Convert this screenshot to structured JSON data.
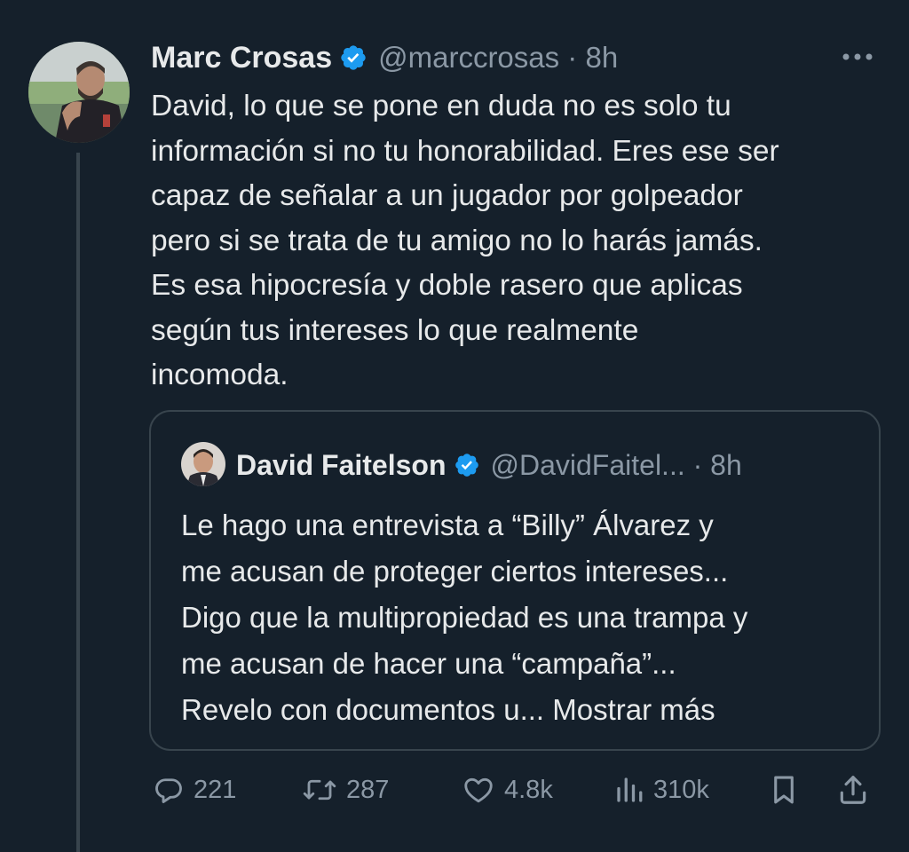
{
  "tweet": {
    "author_name": "Marc Crosas",
    "handle_time": "@marccrosas · 8h",
    "text_lines": [
      "David, lo que se pone en duda no es solo tu",
      "información si no tu honorabilidad. Eres ese ser",
      "capaz de señalar a un jugador por golpeador",
      "pero si se trata de tu amigo no lo harás jamás.",
      "Es esa hipocresía y doble rasero que aplicas",
      "según tus intereses lo que realmente",
      "incomoda."
    ]
  },
  "quote": {
    "author_name": "David Faitelson",
    "handle_time": "@DavidFaitel... · 8h",
    "text_lines": [
      "Le hago una entrevista a “Billy” Álvarez y",
      "me acusan de proteger ciertos intereses...",
      "Digo que la multipropiedad es una trampa y",
      "me acusan de hacer una “campaña”...",
      "Revelo con documentos u... Mostrar más"
    ]
  },
  "actions": {
    "replies": "221",
    "retweets": "287",
    "likes": "4.8k",
    "views": "310k"
  },
  "icons": {
    "more": "more-dots-icon",
    "verified": "verified-badge-icon",
    "reply": "reply-bubble-icon",
    "retweet": "retweet-icon",
    "like": "heart-icon",
    "views": "views-bars-icon",
    "bookmark": "bookmark-icon",
    "share": "share-icon"
  },
  "colors": {
    "background": "#15202b",
    "text": "#e7e9ea",
    "secondary": "#8b98a5",
    "border": "#38444d",
    "verified": "#1d9bf0"
  }
}
